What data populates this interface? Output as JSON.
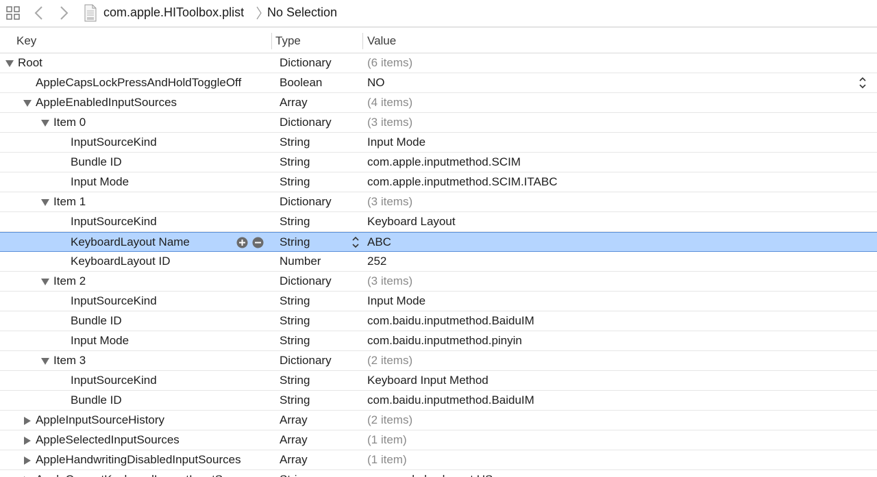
{
  "jumpbar": {
    "file_name": "com.apple.HIToolbox.plist",
    "selection": "No Selection"
  },
  "columns": {
    "key": "Key",
    "type": "Type",
    "value": "Value"
  },
  "rows": [
    {
      "key": "Root",
      "type": "Dictionary",
      "value": "(6 items)",
      "level": 0,
      "disclosure": "open",
      "dim": true
    },
    {
      "key": "AppleCapsLockPressAndHoldToggleOff",
      "type": "Boolean",
      "value": "NO",
      "level": 1,
      "disclosure": "none",
      "dim": false
    },
    {
      "key": "AppleEnabledInputSources",
      "type": "Array",
      "value": "(4 items)",
      "level": 1,
      "disclosure": "open",
      "dim": true
    },
    {
      "key": "Item 0",
      "type": "Dictionary",
      "value": "(3 items)",
      "level": 2,
      "disclosure": "open",
      "dim": true
    },
    {
      "key": "InputSourceKind",
      "type": "String",
      "value": "Input Mode",
      "level": 3,
      "disclosure": "none",
      "dim": false
    },
    {
      "key": "Bundle ID",
      "type": "String",
      "value": "com.apple.inputmethod.SCIM",
      "level": 3,
      "disclosure": "none",
      "dim": false
    },
    {
      "key": "Input Mode",
      "type": "String",
      "value": "com.apple.inputmethod.SCIM.ITABC",
      "level": 3,
      "disclosure": "none",
      "dim": false
    },
    {
      "key": "Item 1",
      "type": "Dictionary",
      "value": "(3 items)",
      "level": 2,
      "disclosure": "open",
      "dim": true
    },
    {
      "key": "InputSourceKind",
      "type": "String",
      "value": "Keyboard Layout",
      "level": 3,
      "disclosure": "none",
      "dim": false
    },
    {
      "key": "KeyboardLayout Name",
      "type": "String",
      "value": "ABC",
      "level": 3,
      "disclosure": "none",
      "dim": false,
      "selected": true
    },
    {
      "key": "KeyboardLayout ID",
      "type": "Number",
      "value": "252",
      "level": 3,
      "disclosure": "none",
      "dim": false
    },
    {
      "key": "Item 2",
      "type": "Dictionary",
      "value": "(3 items)",
      "level": 2,
      "disclosure": "open",
      "dim": true
    },
    {
      "key": "InputSourceKind",
      "type": "String",
      "value": "Input Mode",
      "level": 3,
      "disclosure": "none",
      "dim": false
    },
    {
      "key": "Bundle ID",
      "type": "String",
      "value": "com.baidu.inputmethod.BaiduIM",
      "level": 3,
      "disclosure": "none",
      "dim": false
    },
    {
      "key": "Input Mode",
      "type": "String",
      "value": "com.baidu.inputmethod.pinyin",
      "level": 3,
      "disclosure": "none",
      "dim": false
    },
    {
      "key": "Item 3",
      "type": "Dictionary",
      "value": "(2 items)",
      "level": 2,
      "disclosure": "open",
      "dim": true
    },
    {
      "key": "InputSourceKind",
      "type": "String",
      "value": "Keyboard Input Method",
      "level": 3,
      "disclosure": "none",
      "dim": false
    },
    {
      "key": "Bundle ID",
      "type": "String",
      "value": "com.baidu.inputmethod.BaiduIM",
      "level": 3,
      "disclosure": "none",
      "dim": false
    },
    {
      "key": "AppleInputSourceHistory",
      "type": "Array",
      "value": "(2 items)",
      "level": 1,
      "disclosure": "closed",
      "dim": true
    },
    {
      "key": "AppleSelectedInputSources",
      "type": "Array",
      "value": "(1 item)",
      "level": 1,
      "disclosure": "closed",
      "dim": true
    },
    {
      "key": "AppleHandwritingDisabledInputSources",
      "type": "Array",
      "value": "(1 item)",
      "level": 1,
      "disclosure": "closed",
      "dim": true
    },
    {
      "key": "AppleCurrentKeyboardLayoutInputSo...",
      "type": "String",
      "value": "com.apple.keylayout.US",
      "level": 1,
      "disclosure": "closed",
      "dim": false
    }
  ],
  "colors": {
    "selection_fill": "#b5d5ff",
    "selection_border": "#5a8fd8",
    "dim_text": "#8a8a8a"
  },
  "icons": {
    "grid": "related-items-grid-icon",
    "back": "chevron-left-icon",
    "forward": "chevron-right-icon",
    "file": "plist-file-icon",
    "separator": "path-separator-icon",
    "disclosure_open": "triangle-down-icon",
    "disclosure_closed": "triangle-right-icon",
    "add": "plus-circle-icon",
    "remove": "minus-circle-icon",
    "stepper": "up-down-stepper-icon"
  }
}
